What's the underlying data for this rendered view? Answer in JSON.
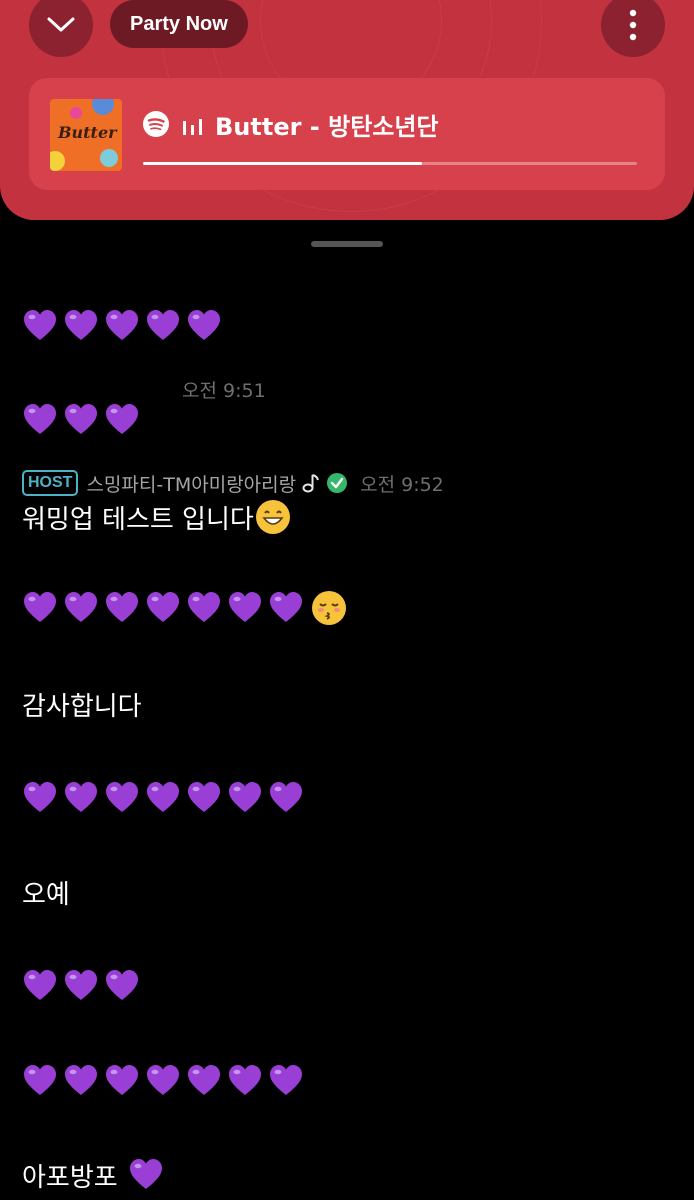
{
  "header": {
    "party_label": "Party Now",
    "track_title": "Butter - 방탄소년단",
    "album_art_text": "Butter",
    "progress": 0.565,
    "accent_color": "#c2333f"
  },
  "messages": {
    "m1": {
      "hearts": 5
    },
    "t1": {
      "time": "오전 9:51"
    },
    "m2": {
      "hearts": 3
    },
    "host": {
      "badge": "HOST",
      "name": "스밍파티-TM아미랑아리랑",
      "time": "오전 9:52"
    },
    "m3": {
      "text": "워밍업 테스트 입니다"
    },
    "m4": {
      "hearts": 7
    },
    "m5": {
      "text": "감사합니다"
    },
    "m6": {
      "hearts": 7
    },
    "m7": {
      "text": "오예"
    },
    "m8": {
      "hearts": 3
    },
    "m9": {
      "hearts": 7
    },
    "m10": {
      "text": "아포방포"
    }
  },
  "colors": {
    "heart": "#9a3fd6",
    "host_badge": "#4fb2c4",
    "verified": "#35b86a"
  }
}
